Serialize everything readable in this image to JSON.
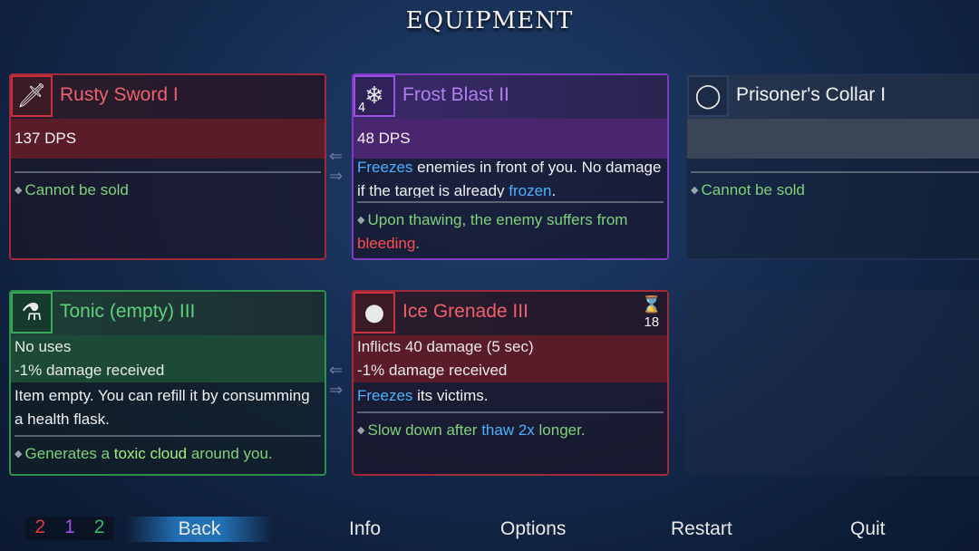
{
  "title": "EQUIPMENT",
  "cards": {
    "rusty_sword": {
      "name": "Rusty Sword I",
      "stat": "137 DPS",
      "bullet": "Cannot be sold",
      "icon": "sword-icon"
    },
    "frost_blast": {
      "name": "Frost Blast II",
      "level": "4",
      "stat": "48 DPS",
      "desc_a": "Freezes",
      "desc_b": " enemies in front of you. No damage if the target is already ",
      "desc_c": "frozen",
      "desc_d": ".",
      "bullet_a": "Upon thawing, the enemy suffers from ",
      "bullet_b": "bleeding",
      "bullet_c": ".",
      "icon": "ice-shard-icon"
    },
    "prisoners_collar": {
      "name": "Prisoner's Collar I",
      "bullet": "Cannot be sold",
      "icon": "collar-icon"
    },
    "tonic": {
      "name": "Tonic (empty) III",
      "stat1": "No uses",
      "stat2": "-1% damage received",
      "desc": "Item empty. You can refill it by consumming a health flask.",
      "bullet_a": "Generates a ",
      "bullet_b": "toxic cloud",
      "bullet_c": " around you.",
      "icon": "flask-icon"
    },
    "ice_grenade": {
      "name": "Ice Grenade III",
      "cooldown": "18",
      "stat1": "Inflicts 40 damage (5 sec)",
      "stat2": "-1% damage received",
      "desc_a": "Freezes",
      "desc_b": " its victims.",
      "bullet_a": "Slow down after ",
      "bullet_b": "thaw 2x",
      "bullet_c": " longer.",
      "icon": "ice-grenade-icon"
    }
  },
  "counts": {
    "red": "2",
    "purple": "1",
    "green": "2"
  },
  "colors": {
    "red": "#f0606a",
    "purple": "#b07ff0",
    "green": "#5ed07a",
    "blue": "#4ab0ff",
    "bleed": "#ff4a4a"
  },
  "nav": {
    "back": "Back",
    "info": "Info",
    "options": "Options",
    "restart": "Restart",
    "quit": "Quit"
  }
}
